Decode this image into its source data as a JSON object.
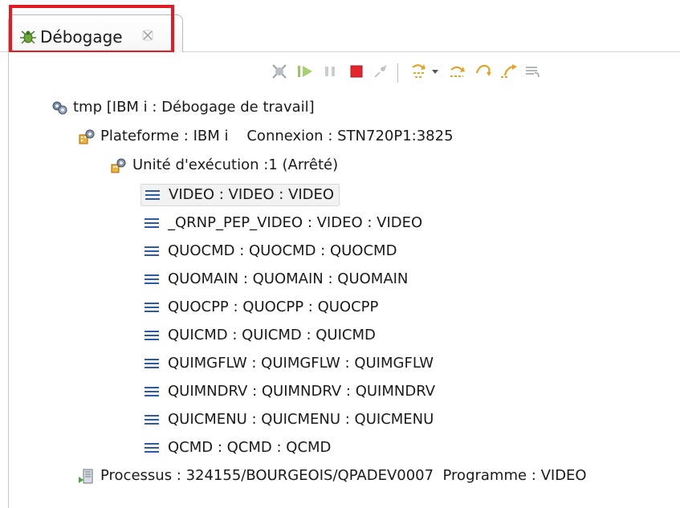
{
  "tab": {
    "label": "Débogage",
    "icon": "debug-bug-icon",
    "close_icon": "close-view-icon"
  },
  "toolbar": {
    "buttons": [
      {
        "icon": "remove-terminated-icon"
      },
      {
        "icon": "resume-icon"
      },
      {
        "icon": "suspend-icon"
      },
      {
        "icon": "terminate-icon"
      },
      {
        "icon": "disconnect-icon"
      },
      {
        "icon": "step-into-icon"
      },
      {
        "icon": "dropdown-arrow-icon"
      },
      {
        "icon": "step-over-icon"
      },
      {
        "icon": "step-return-icon"
      },
      {
        "icon": "drop-to-frame-icon"
      },
      {
        "icon": "step-filters-icon"
      }
    ]
  },
  "tree": {
    "launch": "tmp [IBM i : Débogage de travail]",
    "platform": "Plateforme : IBM i    Connexion : STN720P1:3825",
    "thread": "Unité d'exécution :1 (Arrêté)",
    "frames": [
      "VIDEO : VIDEO : VIDEO",
      "_QRNP_PEP_VIDEO : VIDEO : VIDEO",
      "QUOCMD : QUOCMD : QUOCMD",
      "QUOMAIN : QUOMAIN : QUOMAIN",
      "QUOCPP : QUOCPP : QUOCPP",
      "QUICMD : QUICMD : QUICMD",
      "QUIMGFLW : QUIMGFLW : QUIMGFLW",
      "QUIMNDRV : QUIMNDRV : QUIMNDRV",
      "QUICMENU : QUICMENU : QUICMENU",
      "QCMD : QCMD : QCMD"
    ],
    "process": "Processus : 324155/BOURGEOIS/QPADEV0007  Programme : VIDEO"
  },
  "colors": {
    "highlight": "#e31b23",
    "frame_icon": "#2d5aa8"
  }
}
